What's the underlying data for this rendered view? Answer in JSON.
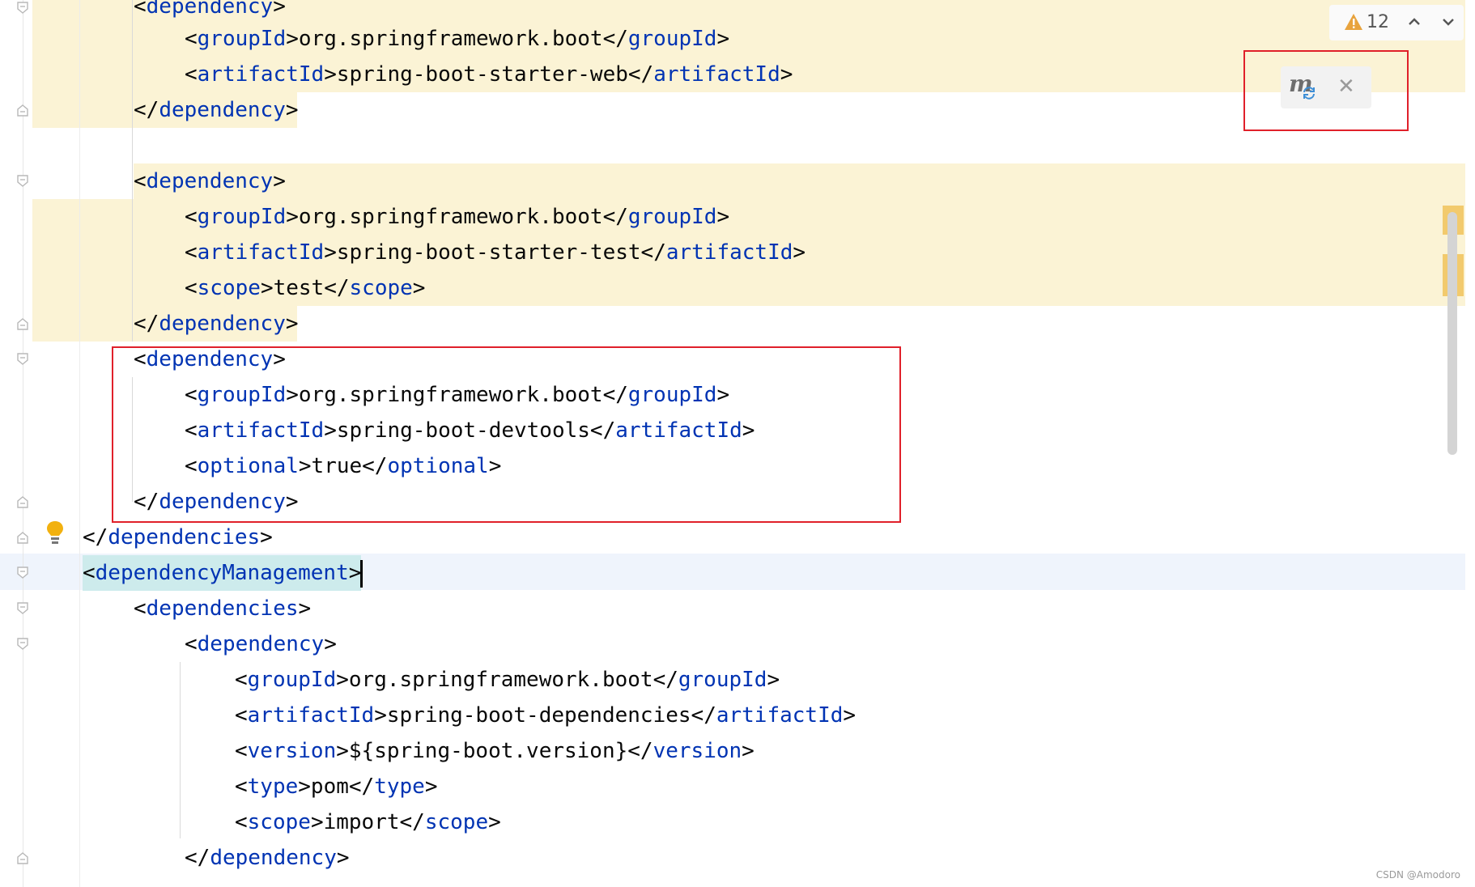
{
  "editor": {
    "lines": [
      {
        "open": "<",
        "tag": "dependency",
        "close": ">",
        "indent": 0
      },
      {
        "text": "<groupId>org.springframework.boot</groupId>"
      },
      {
        "text": "<artifactId>spring-boot-starter-web</artifactId>"
      },
      {
        "text": "</dependency>"
      },
      {
        "text": "<dependency>"
      },
      {
        "text": "<groupId>org.springframework.boot</groupId>"
      },
      {
        "text": "<artifactId>spring-boot-starter-test</artifactId>"
      },
      {
        "text": "<scope>test</scope>"
      },
      {
        "text": "</dependency>"
      },
      {
        "text": "<dependency>"
      },
      {
        "text": "<groupId>org.springframework.boot</groupId>"
      },
      {
        "text": "<artifactId>spring-boot-devtools</artifactId>"
      },
      {
        "text": "<optional>true</optional>"
      },
      {
        "text": "</dependency>"
      },
      {
        "text": "</dependencies>"
      },
      {
        "text": "<dependencyManagement>"
      },
      {
        "text": "<dependencies>"
      },
      {
        "text": "<dependency>"
      },
      {
        "text": "<groupId>org.springframework.boot</groupId>"
      },
      {
        "text": "<artifactId>spring-boot-dependencies</artifactId>"
      },
      {
        "text": "<version>${spring-boot.version}</version>"
      },
      {
        "text": "<type>pom</type>"
      },
      {
        "text": "<scope>import</scope>"
      },
      {
        "text": "</dependency>"
      }
    ]
  },
  "code": {
    "l0": {
      "a": "<",
      "tag": "dependency",
      "b": ">"
    },
    "l1": {
      "a": "<",
      "t1": "groupId",
      "m": ">org.springframework.boot</",
      "t2": "groupId",
      "b": ">"
    },
    "l2": {
      "a": "<",
      "t1": "artifactId",
      "m": ">spring-boot-starter-web</",
      "t2": "artifactId",
      "b": ">"
    },
    "l3": {
      "a": "</",
      "tag": "dependency",
      "b": ">"
    },
    "l4": {
      "a": "<",
      "tag": "dependency",
      "b": ">"
    },
    "l5": {
      "a": "<",
      "t1": "groupId",
      "m": ">org.springframework.boot</",
      "t2": "groupId",
      "b": ">"
    },
    "l6": {
      "a": "<",
      "t1": "artifactId",
      "m": ">spring-boot-starter-test</",
      "t2": "artifactId",
      "b": ">"
    },
    "l7": {
      "a": "<",
      "t1": "scope",
      "m": ">test</",
      "t2": "scope",
      "b": ">"
    },
    "l8": {
      "a": "</",
      "tag": "dependency",
      "b": ">"
    },
    "l9": {
      "a": "<",
      "tag": "dependency",
      "b": ">"
    },
    "l10": {
      "a": "<",
      "t1": "groupId",
      "m": ">org.springframework.boot</",
      "t2": "groupId",
      "b": ">"
    },
    "l11": {
      "a": "<",
      "t1": "artifactId",
      "m": ">spring-boot-devtools</",
      "t2": "artifactId",
      "b": ">"
    },
    "l12": {
      "a": "<",
      "t1": "optional",
      "m": ">true</",
      "t2": "optional",
      "b": ">"
    },
    "l13": {
      "a": "</",
      "tag": "dependency",
      "b": ">"
    },
    "l14": {
      "a": "</",
      "tag": "dependencies",
      "b": ">"
    },
    "l15": {
      "a": "<",
      "tag": "dependencyManagement",
      "b": ">"
    },
    "l16": {
      "a": "<",
      "tag": "dependencies",
      "b": ">"
    },
    "l17": {
      "a": "<",
      "tag": "dependency",
      "b": ">"
    },
    "l18": {
      "a": "<",
      "t1": "groupId",
      "m": ">org.springframework.boot</",
      "t2": "groupId",
      "b": ">"
    },
    "l19": {
      "a": "<",
      "t1": "artifactId",
      "m": ">spring-boot-dependencies</",
      "t2": "artifactId",
      "b": ">"
    },
    "l20": {
      "a": "<",
      "t1": "version",
      "m": ">${spring-boot.version}</",
      "t2": "version",
      "b": ">"
    },
    "l21": {
      "a": "<",
      "t1": "type",
      "m": ">pom</",
      "t2": "type",
      "b": ">"
    },
    "l22": {
      "a": "<",
      "t1": "scope",
      "m": ">import</",
      "t2": "scope",
      "b": ">"
    },
    "l23": {
      "a": "</",
      "tag": "dependency",
      "b": ">"
    }
  },
  "inspections": {
    "warning_count": "12",
    "warning_icon": "warning-triangle-icon",
    "prev_icon": "chevron-up-icon",
    "next_icon": "chevron-down-icon"
  },
  "maven_popup": {
    "icon": "maven-reload-icon",
    "logo_text": "m",
    "close_icon": "close-icon"
  },
  "watermark": "CSDN @Amodoro",
  "colors": {
    "tag": "#0033b3",
    "text": "#080808",
    "highlight_bg": "#fbf3d5",
    "caret_line_bg": "#eff4fc",
    "matched_tag_bg": "#cdebec",
    "annotation_box": "#e0202a",
    "warning": "#e8a33d"
  }
}
